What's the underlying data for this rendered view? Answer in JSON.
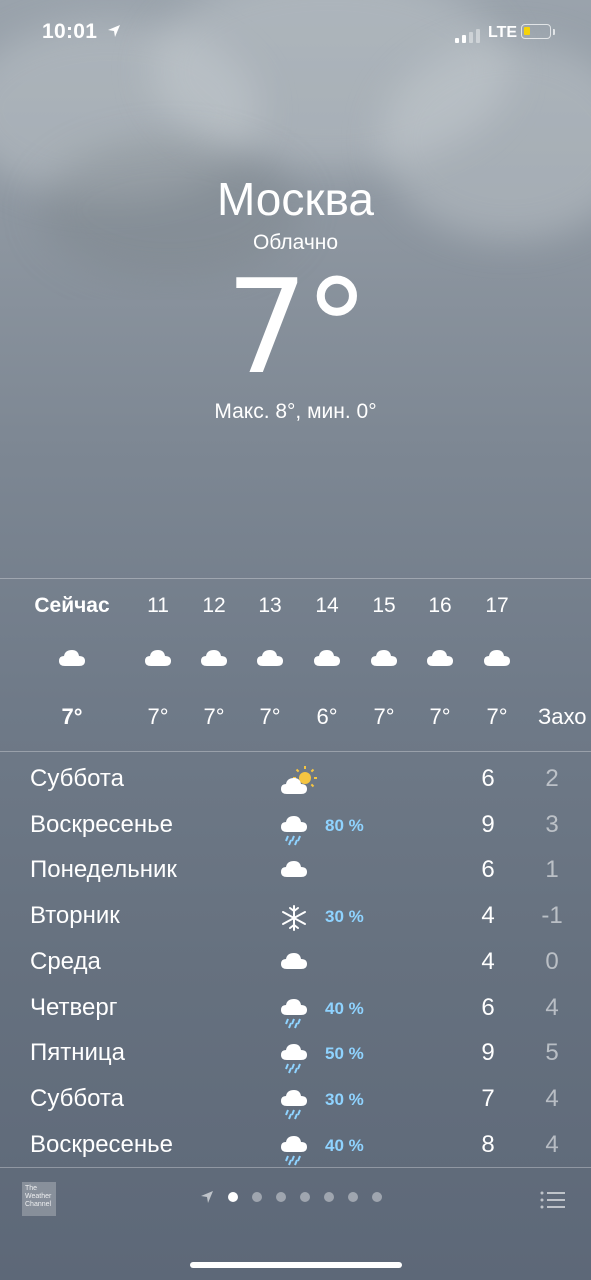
{
  "status": {
    "time": "10:01",
    "network": "LTE"
  },
  "header": {
    "city": "Москва",
    "condition": "Облачно",
    "temperature": "7",
    "degree": "°",
    "hilo": "Макс. 8°, мин. 0°"
  },
  "hourly": [
    {
      "label": "Сейчас",
      "temp": "7°",
      "icon": "cloud-icon"
    },
    {
      "label": "11",
      "temp": "7°",
      "icon": "cloud-icon"
    },
    {
      "label": "12",
      "temp": "7°",
      "icon": "cloud-icon"
    },
    {
      "label": "13",
      "temp": "7°",
      "icon": "cloud-icon"
    },
    {
      "label": "14",
      "temp": "6°",
      "icon": "cloud-icon"
    },
    {
      "label": "15",
      "temp": "7°",
      "icon": "cloud-icon"
    },
    {
      "label": "16",
      "temp": "7°",
      "icon": "cloud-icon"
    },
    {
      "label": "17",
      "temp": "7°",
      "icon": "cloud-icon"
    },
    {
      "label": "",
      "temp": "Захо",
      "icon": ""
    }
  ],
  "daily": [
    {
      "day": "Суббота",
      "icon": "sun-cloud-icon",
      "prob": "",
      "hi": "6",
      "lo": "2"
    },
    {
      "day": "Воскресенье",
      "icon": "rain-icon",
      "prob": "80 %",
      "hi": "9",
      "lo": "3"
    },
    {
      "day": "Понедельник",
      "icon": "cloud-icon",
      "prob": "",
      "hi": "6",
      "lo": "1"
    },
    {
      "day": "Вторник",
      "icon": "snow-icon",
      "prob": "30 %",
      "hi": "4",
      "lo": "-1"
    },
    {
      "day": "Среда",
      "icon": "cloud-icon",
      "prob": "",
      "hi": "4",
      "lo": "0"
    },
    {
      "day": "Четверг",
      "icon": "rain-icon",
      "prob": "40 %",
      "hi": "6",
      "lo": "4"
    },
    {
      "day": "Пятница",
      "icon": "rain-icon",
      "prob": "50 %",
      "hi": "9",
      "lo": "5"
    },
    {
      "day": "Суббота",
      "icon": "rain-icon",
      "prob": "30 %",
      "hi": "7",
      "lo": "4"
    },
    {
      "day": "Воскресенье",
      "icon": "rain-icon",
      "prob": "40 %",
      "hi": "8",
      "lo": "4"
    }
  ],
  "footer": {
    "logo_text": "The Weather Channel",
    "pages": 7,
    "active_page": 0
  },
  "colors": {
    "precip": "#8fd3ff",
    "sun": "#f5c542",
    "battery": "#f5d30b"
  }
}
